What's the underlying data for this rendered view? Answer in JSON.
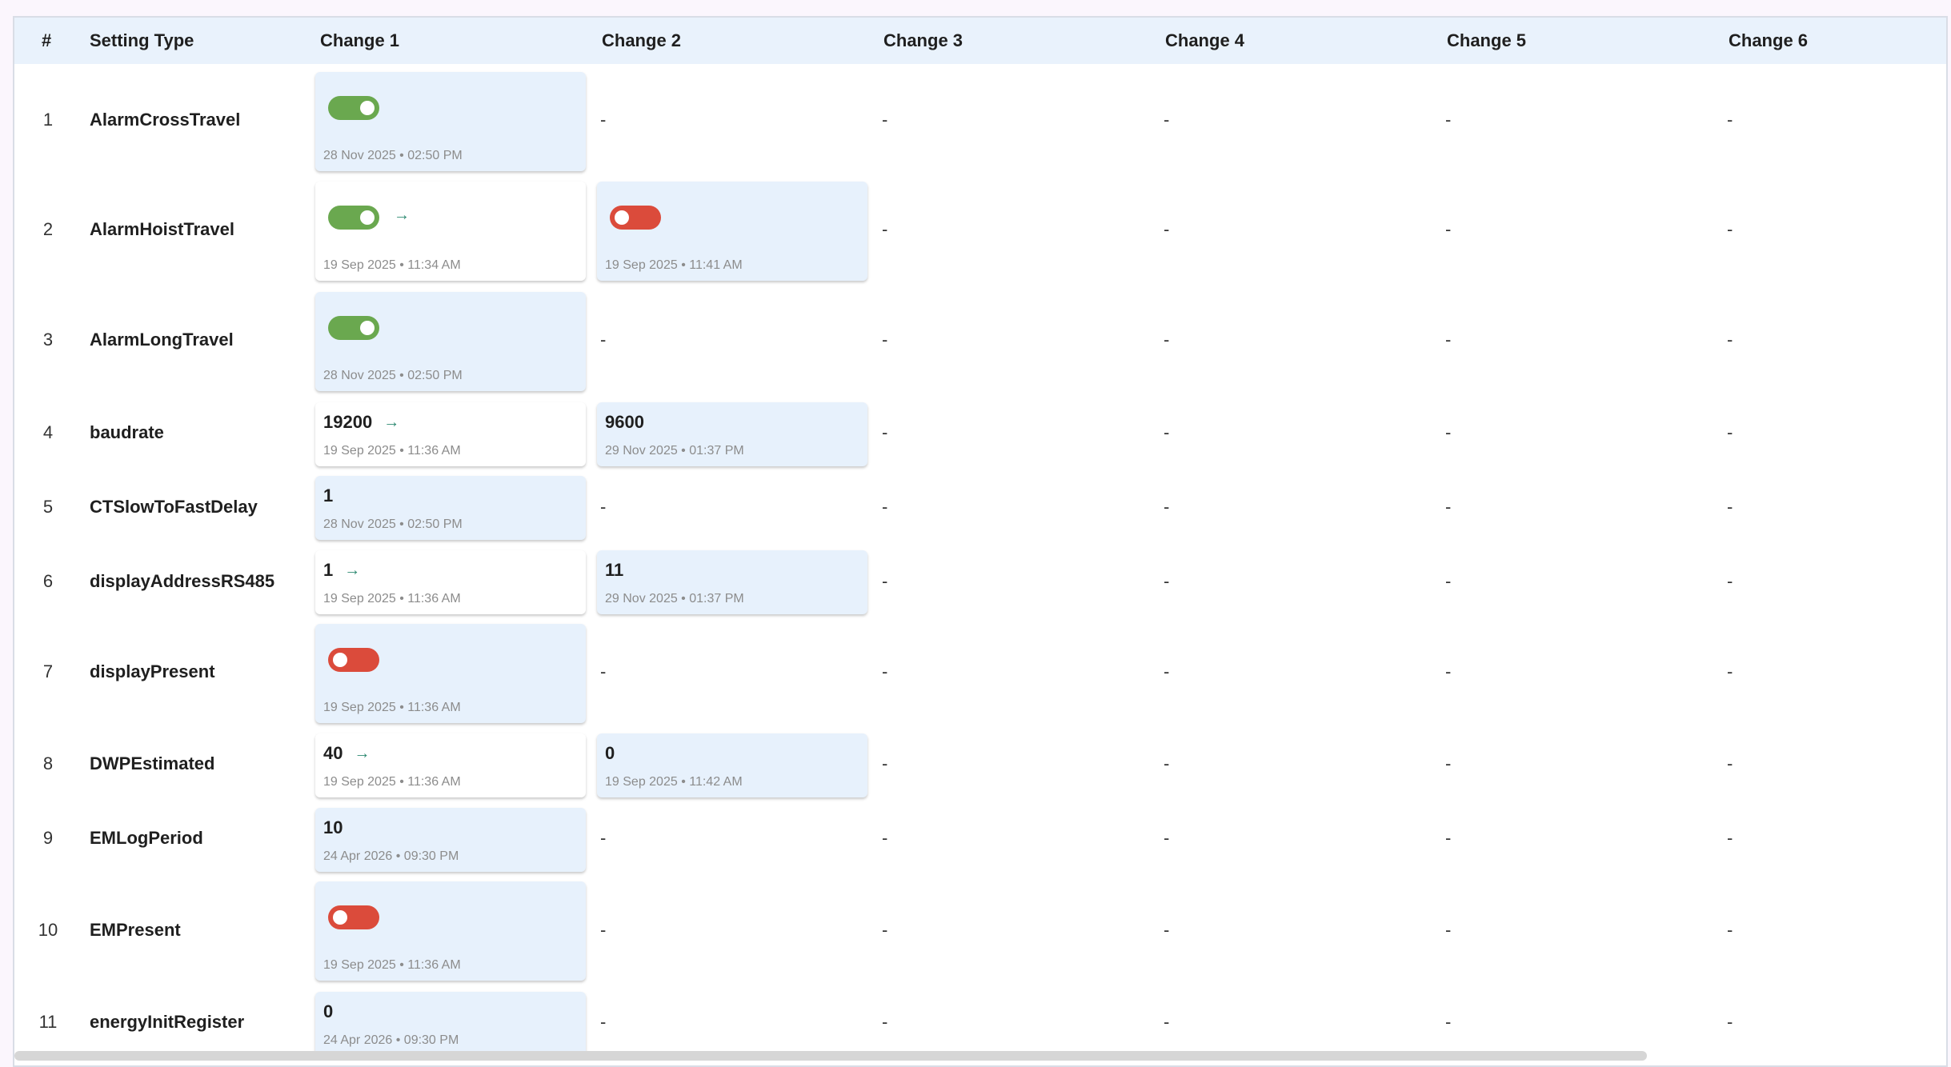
{
  "headers": [
    "#",
    "Setting Type",
    "Change 1",
    "Change 2",
    "Change 3",
    "Change 4",
    "Change 5",
    "Change 6"
  ],
  "empty": "-",
  "rows": [
    {
      "num": "1",
      "type": "AlarmCrossTravel",
      "c1": {
        "kind": "toggle",
        "state": "on",
        "ts": "28 Nov 2025 • 02:50 PM",
        "current": true
      }
    },
    {
      "num": "2",
      "type": "AlarmHoistTravel",
      "c1": {
        "kind": "toggle",
        "state": "on",
        "ts": "19 Sep 2025 • 11:34 AM",
        "current": false
      },
      "c2": {
        "kind": "toggle",
        "state": "off",
        "ts": "19 Sep 2025 • 11:41 AM",
        "current": true
      }
    },
    {
      "num": "3",
      "type": "AlarmLongTravel",
      "c1": {
        "kind": "toggle",
        "state": "on",
        "ts": "28 Nov 2025 • 02:50 PM",
        "current": true
      }
    },
    {
      "num": "4",
      "type": "baudrate",
      "c1": {
        "kind": "value",
        "value": "19200",
        "ts": "19 Sep 2025 • 11:36 AM",
        "current": false
      },
      "c2": {
        "kind": "value",
        "value": "9600",
        "ts": "29 Nov 2025 • 01:37 PM",
        "current": true
      }
    },
    {
      "num": "5",
      "type": "CTSlowToFastDelay",
      "c1": {
        "kind": "value",
        "value": "1",
        "ts": "28 Nov 2025 • 02:50 PM",
        "current": true
      }
    },
    {
      "num": "6",
      "type": "displayAddressRS485",
      "c1": {
        "kind": "value",
        "value": "1",
        "ts": "19 Sep 2025 • 11:36 AM",
        "current": false
      },
      "c2": {
        "kind": "value",
        "value": "11",
        "ts": "29 Nov 2025 • 01:37 PM",
        "current": true
      }
    },
    {
      "num": "7",
      "type": "displayPresent",
      "c1": {
        "kind": "toggle",
        "state": "off",
        "ts": "19 Sep 2025 • 11:36 AM",
        "current": true
      }
    },
    {
      "num": "8",
      "type": "DWPEstimated",
      "c1": {
        "kind": "value",
        "value": "40",
        "ts": "19 Sep 2025 • 11:36 AM",
        "current": false
      },
      "c2": {
        "kind": "value",
        "value": "0",
        "ts": "19 Sep 2025 • 11:42 AM",
        "current": true
      }
    },
    {
      "num": "9",
      "type": "EMLogPeriod",
      "c1": {
        "kind": "value",
        "value": "10",
        "ts": "24 Apr 2026 • 09:30 PM",
        "current": true
      }
    },
    {
      "num": "10",
      "type": "EMPresent",
      "c1": {
        "kind": "toggle",
        "state": "off",
        "ts": "19 Sep 2025 • 11:36 AM",
        "current": true
      }
    },
    {
      "num": "11",
      "type": "energyInitRegister",
      "c1": {
        "kind": "value",
        "value": "0",
        "ts": "24 Apr 2026 • 09:30 PM",
        "current": true
      }
    }
  ],
  "colors": {
    "header_bg": "#e9f2fc",
    "toggle_on": "#6aa84f",
    "toggle_off": "#db4b3b",
    "arrow": "#2e8a72"
  },
  "icons": {
    "transition": "arrow-right-icon"
  }
}
